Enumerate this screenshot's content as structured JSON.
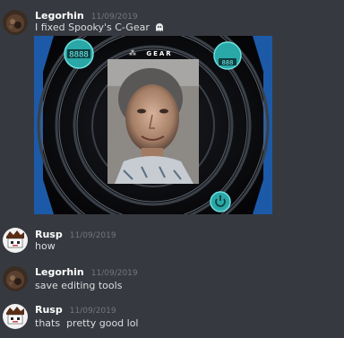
{
  "messages": [
    {
      "author": "Legorhin",
      "timestamp": "11/09/2019",
      "text": "I fixed Spooky's C-Gear",
      "emoji": "ghost-emoji",
      "avatar": "legorhin-avatar-icon",
      "attachment": {
        "brand_text": "GEAR",
        "left_badge": "8888",
        "right_badge": "888",
        "accent_color": "#2aa7a7",
        "ring_color": "#3a4048",
        "side_color": "#1c5aa8",
        "power_icon": "power-icon"
      }
    },
    {
      "author": "Rusp",
      "timestamp": "11/09/2019",
      "text": "how",
      "avatar": "rusp-avatar-icon"
    },
    {
      "author": "Legorhin",
      "timestamp": "11/09/2019",
      "text": "save editing tools",
      "avatar": "legorhin-avatar-icon"
    },
    {
      "author": "Rusp",
      "timestamp": "11/09/2019",
      "text": "thats  pretty good lol",
      "avatar": "rusp-avatar-icon"
    }
  ],
  "colors": {
    "background": "#36393f",
    "username": "#ffffff",
    "timestamp": "#72767d",
    "message_text": "#dcddde"
  }
}
